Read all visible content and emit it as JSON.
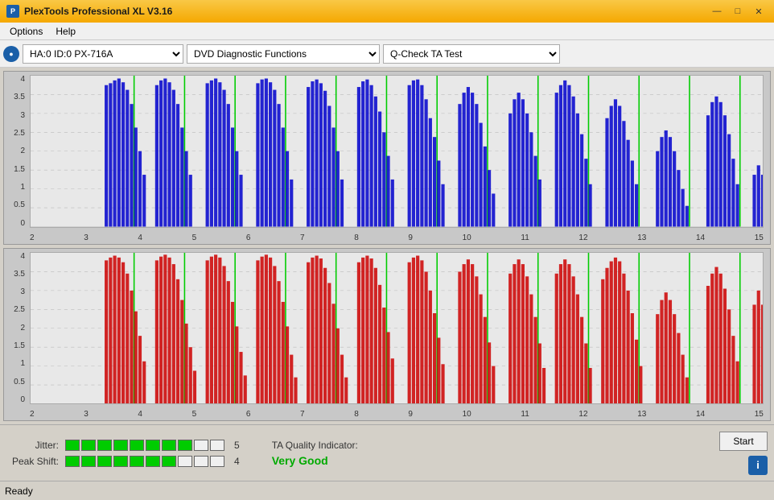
{
  "titleBar": {
    "title": "PlexTools Professional XL V3.16",
    "appIconText": "P"
  },
  "windowControls": {
    "minimize": "—",
    "maximize": "□",
    "close": "✕"
  },
  "menuBar": {
    "items": [
      "Options",
      "Help"
    ]
  },
  "toolbar": {
    "driveLabel": "HA:0 ID:0  PX-716A",
    "functionLabel": "DVD Diagnostic Functions",
    "testLabel": "Q-Check TA Test"
  },
  "charts": {
    "topChart": {
      "color": "blue",
      "yLabels": [
        "4",
        "3.5",
        "3",
        "2.5",
        "2",
        "1.5",
        "1",
        "0.5",
        "0"
      ],
      "xLabels": [
        "2",
        "3",
        "4",
        "5",
        "6",
        "7",
        "8",
        "9",
        "10",
        "11",
        "12",
        "13",
        "14",
        "15"
      ]
    },
    "bottomChart": {
      "color": "red",
      "yLabels": [
        "4",
        "3.5",
        "3",
        "2.5",
        "2",
        "1.5",
        "1",
        "0.5",
        "0"
      ],
      "xLabels": [
        "2",
        "3",
        "4",
        "5",
        "6",
        "7",
        "8",
        "9",
        "10",
        "11",
        "12",
        "13",
        "14",
        "15"
      ]
    }
  },
  "metrics": {
    "jitter": {
      "label": "Jitter:",
      "filledCells": 8,
      "totalCells": 10,
      "value": "5"
    },
    "peakShift": {
      "label": "Peak Shift:",
      "filledCells": 7,
      "totalCells": 10,
      "value": "4"
    },
    "taQuality": {
      "label": "TA Quality Indicator:",
      "value": "Very Good"
    }
  },
  "buttons": {
    "start": "Start"
  },
  "statusBar": {
    "status": "Ready"
  }
}
